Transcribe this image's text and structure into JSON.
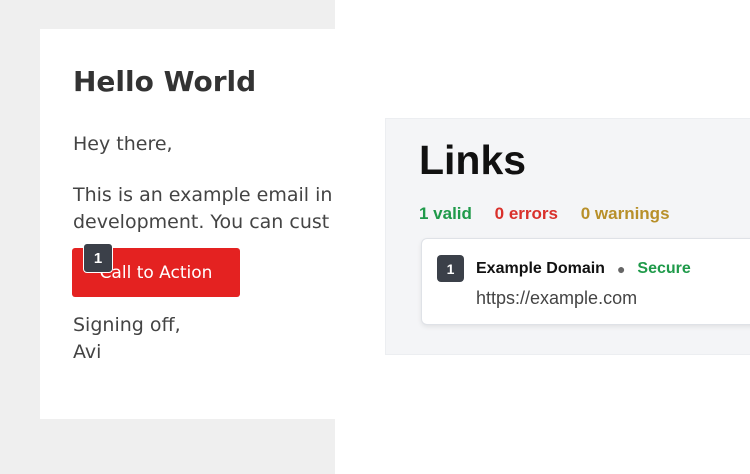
{
  "email": {
    "title": "Hello World",
    "greeting": "Hey there,",
    "body_line1": "This is an example email in",
    "body_line2": "development. You can cust",
    "cta_label": "Call to Action",
    "cta_marker": "1",
    "signoff_line1": "Signing off,",
    "signoff_line2": "Avi"
  },
  "links_panel": {
    "heading": "Links",
    "summary": {
      "valid": "1 valid",
      "errors": "0 errors",
      "warnings": "0 warnings"
    },
    "items": [
      {
        "marker": "1",
        "title": "Example Domain",
        "status": "Secure",
        "url": "https://example.com"
      }
    ]
  },
  "colors": {
    "cta": "#e42221",
    "valid": "#1f9a4a",
    "errors": "#d9302b",
    "warnings": "#b8902a",
    "marker": "#3b4049"
  }
}
